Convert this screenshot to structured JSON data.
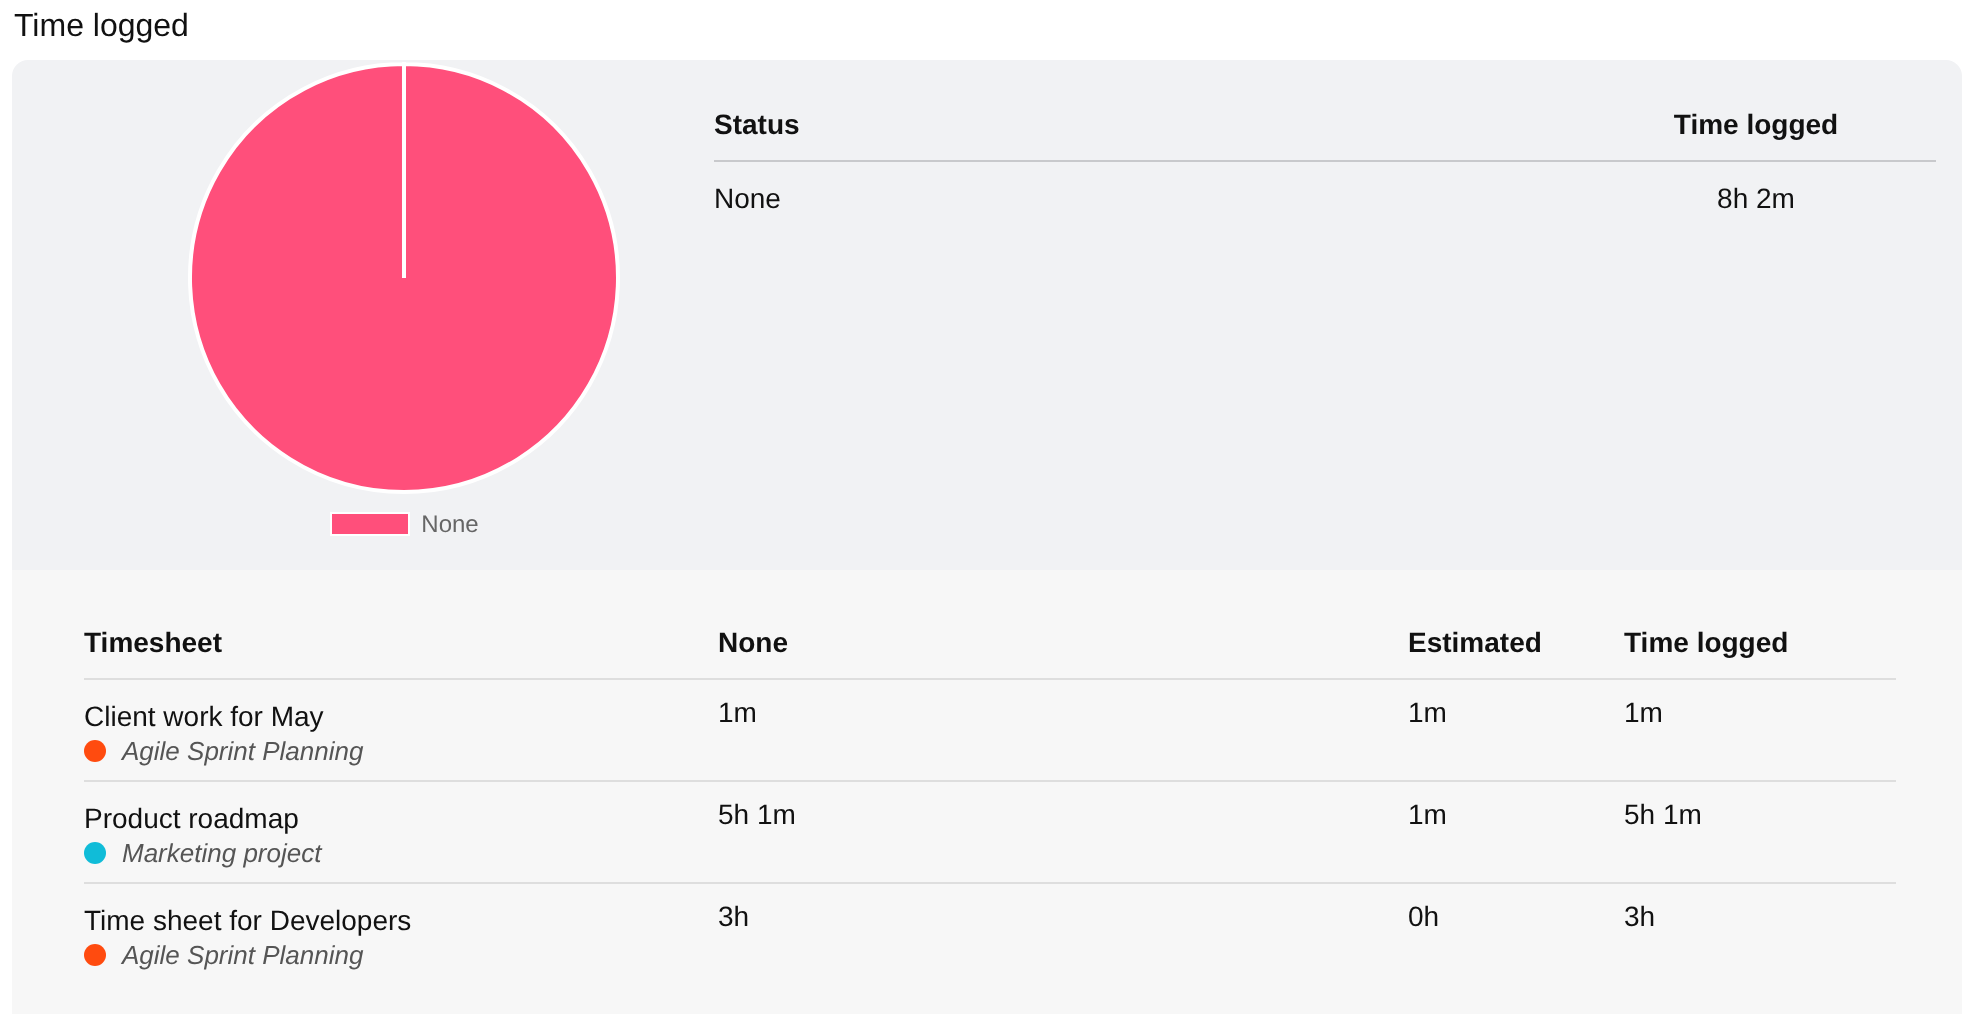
{
  "title": "Time logged",
  "summary": {
    "chart_data": {
      "type": "pie",
      "categories": [
        "None"
      ]
    },
    "table": {
      "columns": [
        "Status",
        "Time logged"
      ],
      "rows": [
        {
          "status": "None",
          "time_logged": "8h 2m"
        }
      ]
    }
  },
  "timesheets": {
    "columns": [
      "Timesheet",
      "None",
      "Estimated",
      "Time logged"
    ],
    "rows": [
      {
        "name": "Client work for May",
        "project": "Agile Sprint Planning",
        "color": "#ff4b0f",
        "none": "1m",
        "estimated": "1m",
        "time_logged": "1m"
      },
      {
        "name": "Product roadmap",
        "project": "Marketing project",
        "color": "#10bcd8",
        "none": "5h 1m",
        "estimated": "1m",
        "time_logged": "5h 1m"
      },
      {
        "name": "Time sheet for Developers",
        "project": "Agile Sprint Planning",
        "color": "#ff4b0f",
        "none": "3h",
        "estimated": "0h",
        "time_logged": "3h"
      }
    ]
  }
}
